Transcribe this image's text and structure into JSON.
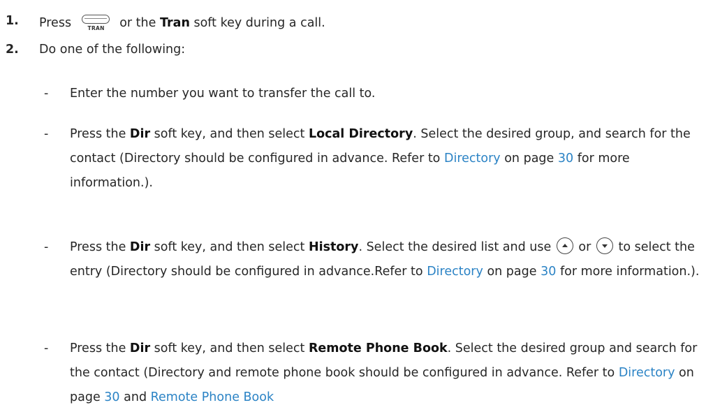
{
  "steps": [
    {
      "num": "1.",
      "parts": {
        "a": "Press",
        "key_icon_label": "TRAN",
        "b": "or the",
        "key": "Tran",
        "c": "soft key during a call."
      }
    },
    {
      "num": "2.",
      "text": "Do one of the following:"
    }
  ],
  "options": [
    {
      "dash": "-",
      "text": "Enter the number you want to transfer the call to."
    },
    {
      "dash": "-",
      "p1": "Press the",
      "k1": "Dir",
      "p2": "soft key, and then select",
      "k2": "Local Directory",
      "p3": ". Select the desired group, and search for the contact (Directory should be configured in advance. Refer to",
      "link": "Directory",
      "p4": "on page",
      "page": "30",
      "p5": "for more information.)."
    },
    {
      "dash": "-",
      "p1": "Press the",
      "k1": "Dir",
      "p2": "soft key, and then select",
      "k2": "History",
      "p3": ". Select the desired list and use",
      "p4": "or",
      "p5": "to select the entry (Directory should be configured in advance.Refer to",
      "link": "Directory",
      "p6": "on page",
      "page": "30",
      "p7": "for more information.)."
    },
    {
      "dash": "-",
      "p1": "Press the",
      "k1": "Dir",
      "p2": "soft key, and then select",
      "k2": "Remote Phone Book",
      "p3": ". Select the desired group and search for the contact (Directory and remote phone book should be configured in advance. Refer to",
      "link": "Directory",
      "p4": "on page",
      "page": "30",
      "p5": "and",
      "link2": "Remote Phone Book"
    }
  ],
  "icons": [
    "tran-key-icon",
    "up-arrow-key-icon",
    "down-arrow-key-icon"
  ],
  "colors": {
    "text": "#262626",
    "link": "#2b83c5"
  }
}
